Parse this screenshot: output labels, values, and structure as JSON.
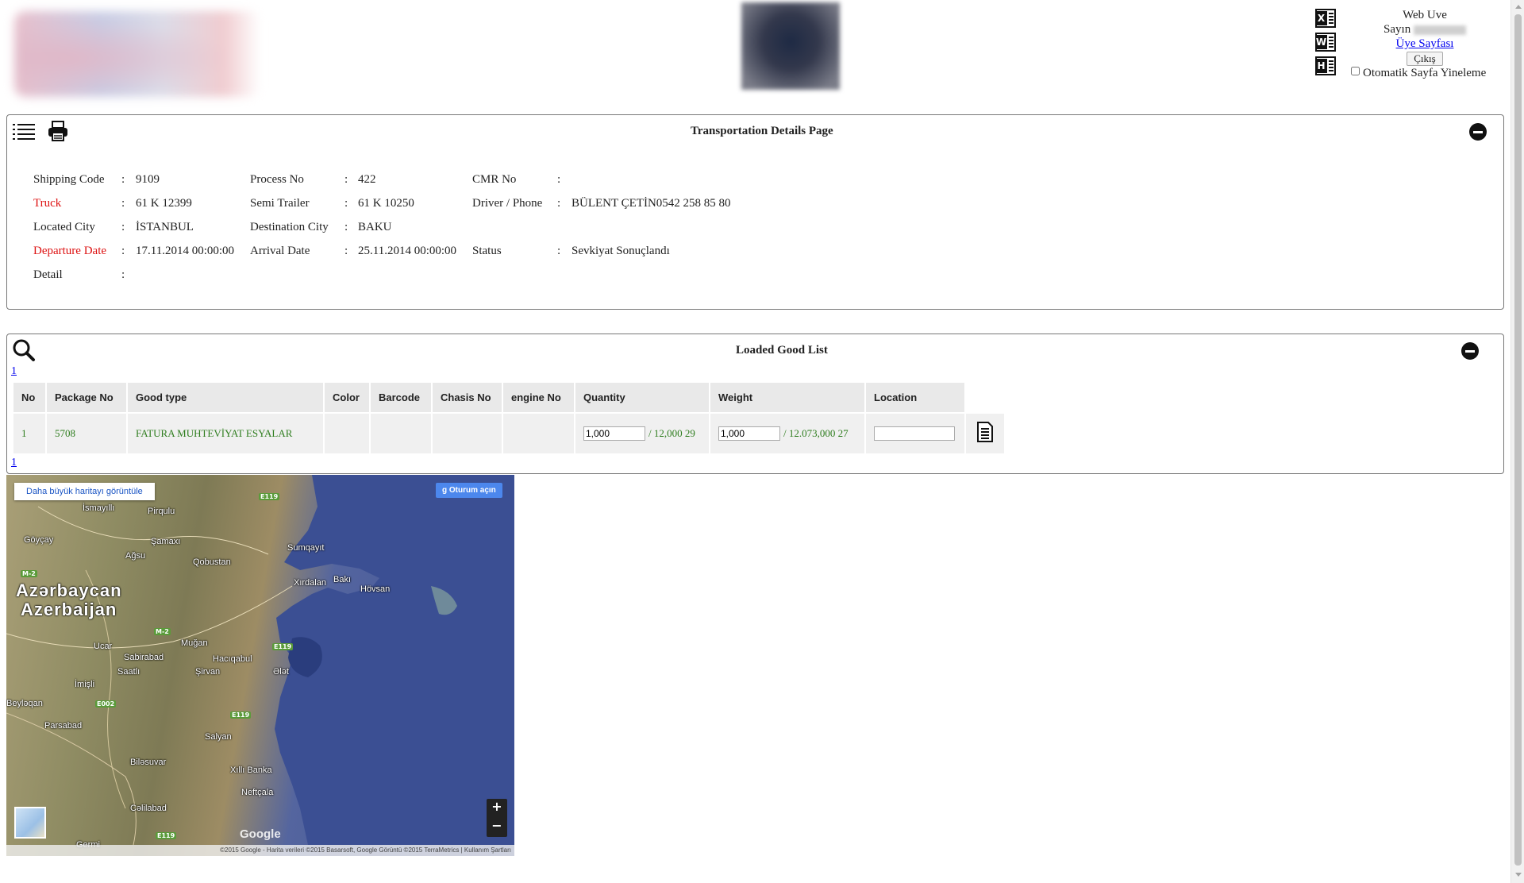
{
  "header": {
    "export_icons": [
      "excel-icon",
      "word-icon",
      "html-icon"
    ],
    "user_line1": "Web  Uve",
    "greeting": "Sayın",
    "member_page_link": "Üye Sayfası",
    "logout_label": "Çıkış",
    "auto_refresh_label": "Otomatik Sayfa Yineleme",
    "auto_refresh_checked": false
  },
  "details": {
    "title": "Transportation Details Page",
    "separator": ":",
    "fields": {
      "shipping_code_label": "Shipping Code",
      "shipping_code": "9109",
      "truck_label": "Truck",
      "truck": "61 K 12399",
      "located_city_label": "Located City",
      "located_city": "İSTANBUL",
      "departure_date_label": "Departure Date",
      "departure_date": "17.11.2014 00:00:00",
      "detail_label": "Detail",
      "detail": "",
      "process_no_label": "Process No",
      "process_no": "422",
      "semi_trailer_label": "Semi Trailer",
      "semi_trailer": "61 K 10250",
      "destination_city_label": "Destination City",
      "destination_city": "BAKU",
      "arrival_date_label": "Arrival Date",
      "arrival_date": "25.11.2014 00:00:00",
      "cmr_no_label": "CMR No",
      "cmr_no": "",
      "driver_phone_label": "Driver / Phone",
      "driver_phone": "BÜLENT ÇETİN0542 258 85 80",
      "status_label": "Status",
      "status": "Sevkiyat Sonuçlandı"
    },
    "label_colors": {
      "highlight": "#dd1111"
    }
  },
  "goods": {
    "title": "Loaded Good List",
    "page_top": "1",
    "page_bottom": "1",
    "columns": [
      "No",
      "Package No",
      "Good type",
      "Color",
      "Barcode",
      "Chasis No",
      "engine No",
      "Quantity",
      "Weight",
      "Location"
    ],
    "rows": [
      {
        "no": "1",
        "package_no": "5708",
        "good_type": "FATURA MUHTEVİYAT ESYALAR",
        "color": "",
        "barcode": "",
        "chasis_no": "",
        "engine_no": "",
        "quantity_input": "1,000",
        "quantity_total": "/ 12,000 29",
        "weight_input": "1,000",
        "weight_total": "/ 12.073,000 27",
        "location_input": ""
      }
    ],
    "value_color": "#2e7d1e"
  },
  "map": {
    "bigger_map_label": "Daha büyük haritayı görüntüle",
    "signin_label": "Oturum açın",
    "zoom_in": "+",
    "zoom_out": "−",
    "logo": "Google",
    "footer": "©2015 Google - Harita verileri ©2015 Basarsoft, Google Görüntü ©2015 TerraMetrics  |  Kullanım Şartları",
    "country_name_local": "Azərbaycan",
    "country_name": "Azerbaijan",
    "places": [
      "İsmayıllı",
      "Pirqulu",
      "Göyçay",
      "Şamaxı",
      "Qobustan",
      "Ağsu",
      "Sumqayıt",
      "Xırdalan",
      "Bakı",
      "Hövsan",
      "Sabirabad",
      "Muğan",
      "Hacıqabul",
      "Saatlı",
      "Şirvan",
      "Ələt",
      "İmişli",
      "Beyləqan",
      "Parsabad",
      "Salyan",
      "Biləsuvar",
      "Xıllı Banka",
      "Neftçala",
      "Cəlilabad",
      "Germi",
      "Ucar"
    ],
    "roads": [
      "E119",
      "M-2",
      "E002"
    ]
  }
}
